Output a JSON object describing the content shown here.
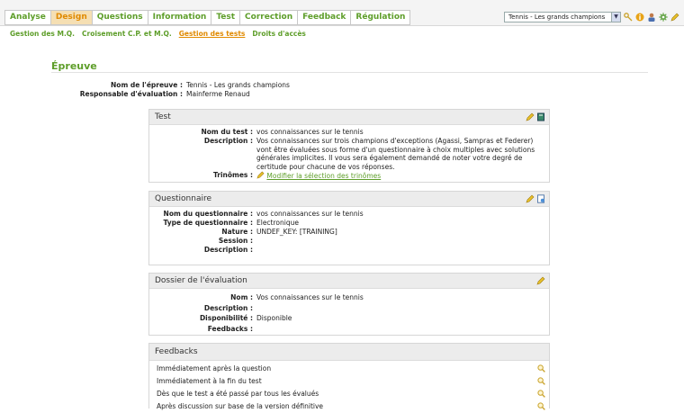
{
  "menu": {
    "tabs": [
      {
        "label": "Analyse",
        "active": false
      },
      {
        "label": "Design",
        "active": true
      },
      {
        "label": "Questions",
        "active": false
      },
      {
        "label": "Information",
        "active": false
      },
      {
        "label": "Test",
        "active": false
      },
      {
        "label": "Correction",
        "active": false
      },
      {
        "label": "Feedback",
        "active": false
      },
      {
        "label": "Régulation",
        "active": false
      }
    ],
    "test_select_value": "Tennis - Les grands champions"
  },
  "subnav": {
    "items": [
      "Gestion des M.Q.",
      "Croisement C.P. et M.Q.",
      "Gestion des tests",
      "Droits d'accès"
    ],
    "active_index": 2
  },
  "page_title": "Épreuve",
  "epreuve": {
    "name_label": "Nom de l'épreuve :",
    "name_value": "Tennis - Les grands champions",
    "resp_label": "Responsable d'évaluation :",
    "resp_value": "Mainferme Renaud"
  },
  "test_panel": {
    "title": "Test",
    "nom_label": "Nom du test :",
    "nom_value": "vos connaissances sur le tennis",
    "desc_label": "Description :",
    "desc_value": "Vos connaissances sur trois champions d'exceptions (Agassi, Sampras et Federer) vont être évaluées sous forme d'un questionnaire à choix multiples avec solutions générales implicites. Il vous sera également demandé de noter votre degré de certitude pour chacune de vos réponses.",
    "trinomes_label": "Trinômes :",
    "trinomes_link": "Modifier la sélection des trinômes"
  },
  "questionnaire_panel": {
    "title": "Questionnaire",
    "rows": [
      {
        "label": "Nom du questionnaire :",
        "value": "vos connaissances sur le tennis"
      },
      {
        "label": "Type de questionnaire :",
        "value": "Electronique"
      },
      {
        "label": "Nature :",
        "value": "UNDEF_KEY: [TRAINING]"
      },
      {
        "label": "Session :",
        "value": ""
      },
      {
        "label": "Description :",
        "value": ""
      }
    ]
  },
  "dossier_panel": {
    "title": "Dossier de l'évaluation",
    "rows": [
      {
        "label": "Nom :",
        "value": "Vos connaissances sur le tennis"
      },
      {
        "label": "Description :",
        "value": ""
      },
      {
        "label": "Disponibilité :",
        "value": "Disponible"
      },
      {
        "label": "Feedbacks :",
        "value": ""
      }
    ]
  },
  "feedbacks_panel": {
    "title": "Feedbacks",
    "items": [
      "Immédiatement après la question",
      "Immédiatement à la fin du test",
      "Dès que le test a été passé par tous les évalués",
      "Après discussion sur base de la version définitive"
    ]
  },
  "colors": {
    "accent_green": "#5e9e2a",
    "active_orange": "#e08a00",
    "active_tab_bg": "#f5dfb3"
  },
  "icons": [
    "pencil-icon",
    "book-icon",
    "document-icon",
    "magnifier-icon",
    "info-icon",
    "user-icon",
    "gear-icon"
  ]
}
